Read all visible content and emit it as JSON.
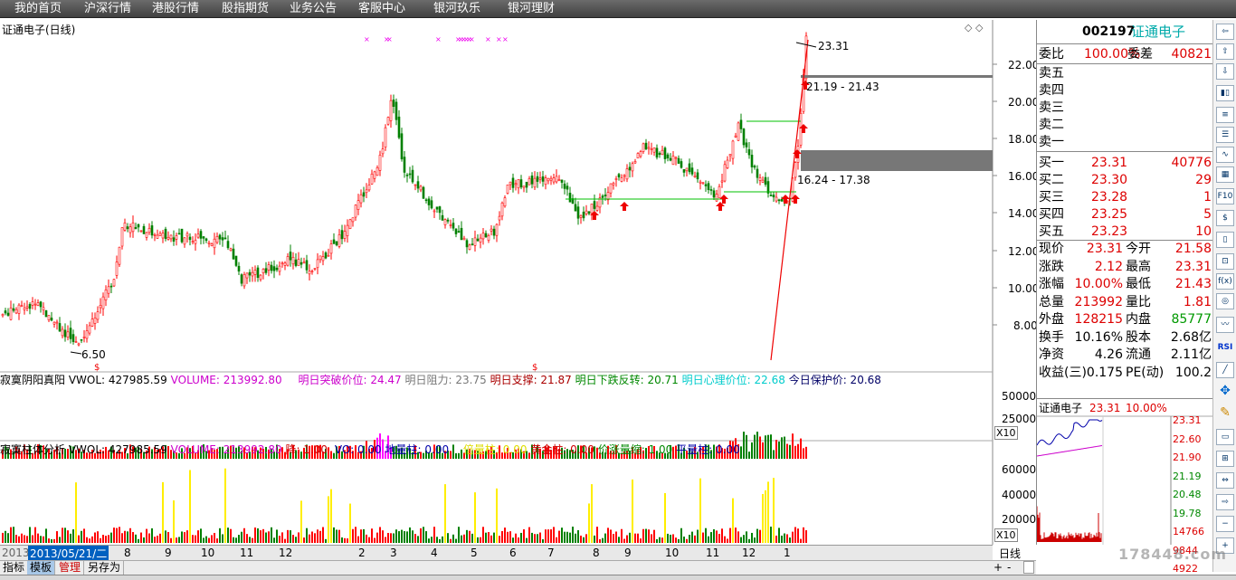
{
  "menu": [
    "我的首页",
    "沪深行情",
    "港股行情",
    "股指期货",
    "业务公告",
    "客服中心",
    "银河玖乐",
    "银河理财"
  ],
  "chart": {
    "title": "证通电子(日线)",
    "price_labels": [
      {
        "text": "23.31"
      },
      {
        "text": "21.19 - 21.43"
      },
      {
        "text": "16.24 - 17.38"
      },
      {
        "text": "6.50"
      }
    ],
    "axis_left_labels": [
      "22.00",
      "20.00",
      "18.00",
      "16.00",
      "14.00",
      "12.00",
      "10.00",
      "8.00"
    ],
    "vol_axis_labels": [
      "50000",
      "25000",
      "X10"
    ],
    "ind_axis_labels": [
      "60000",
      "40000",
      "20000",
      "X10"
    ],
    "header1": {
      "name": "寂寞阴阳真阳",
      "vwol": "VWOL: 427985.59",
      "volume": "VOLUME: 213992.80",
      "breakup": "明日突破价位: 24.47",
      "resist": "明日阻力: 23.75",
      "support": "明日支撑: 21.87",
      "fall": "明日下跌反转: 20.71",
      "psych": "明日心理价位: 22.68",
      "protect": "今日保护价: 20.68"
    },
    "header2": {
      "name": "寂寞柱体分析",
      "vwol": "VWOL: 427985.59",
      "volume": "VOLUME: 213992.80",
      "jiang": "降: 1.00",
      "vo": "VO: 0.00",
      "diliang": "地量柱: 0.00",
      "beiliang": "倍量柱: 0.00",
      "huangjin": "黄金柱: 0.00",
      "jiazhang": "价涨量缩: 1.00",
      "pingliang": "平量柱: 0.00"
    },
    "date_labels": [
      "2013",
      "2013/05/21/二",
      "8",
      "9",
      "10",
      "11",
      "12",
      "2",
      "3",
      "4",
      "5",
      "6",
      "7",
      "8",
      "9",
      "10",
      "11",
      "12",
      "1"
    ]
  },
  "quote": {
    "code": "002197",
    "name": "证通电子",
    "weibi_label": "委比",
    "weibi": "100.00%",
    "weicha_label": "委差",
    "weicha": "40821",
    "sells": [
      "卖五",
      "卖四",
      "卖三",
      "卖二",
      "卖一"
    ],
    "buys": [
      {
        "label": "买一",
        "price": "23.31",
        "vol": "40776"
      },
      {
        "label": "买二",
        "price": "23.30",
        "vol": "29"
      },
      {
        "label": "买三",
        "price": "23.28",
        "vol": "1"
      },
      {
        "label": "买四",
        "price": "23.25",
        "vol": "5"
      },
      {
        "label": "买五",
        "price": "23.23",
        "vol": "10"
      }
    ],
    "stats": [
      {
        "l1": "现价",
        "v1": "23.31",
        "l2": "今开",
        "v2": "21.58"
      },
      {
        "l1": "涨跌",
        "v1": "2.12",
        "l2": "最高",
        "v2": "23.31"
      },
      {
        "l1": "涨幅",
        "v1": "10.00%",
        "l2": "最低",
        "v2": "21.43"
      },
      {
        "l1": "总量",
        "v1": "213992",
        "l2": "量比",
        "v2": "1.81"
      },
      {
        "l1": "外盘",
        "v1": "128215",
        "l2": "内盘",
        "v2": "85777"
      },
      {
        "l1": "换手",
        "v1": "10.16%",
        "l2": "股本",
        "v2": "2.68亿"
      },
      {
        "l1": "净资",
        "v1": "4.26",
        "l2": "流通",
        "v2": "2.11亿"
      },
      {
        "l1": "收益(三)",
        "v1": "0.175",
        "l2": "PE(动)",
        "v2": "100.2"
      }
    ],
    "mini_title": "证通电子",
    "mini_price": "23.31",
    "mini_pct": "10.00%",
    "mini_labels": [
      "23.31",
      "22.60",
      "21.90",
      "21.19",
      "20.48",
      "19.78",
      "14766",
      "9844",
      "4922"
    ]
  },
  "tabs": [
    "指标",
    "模板",
    "管理",
    "另存为"
  ],
  "period_label": "日线",
  "watermark": "178448.com",
  "colors": {
    "up": "#ff0000",
    "down": "#008000",
    "accent": "#d00000"
  }
}
